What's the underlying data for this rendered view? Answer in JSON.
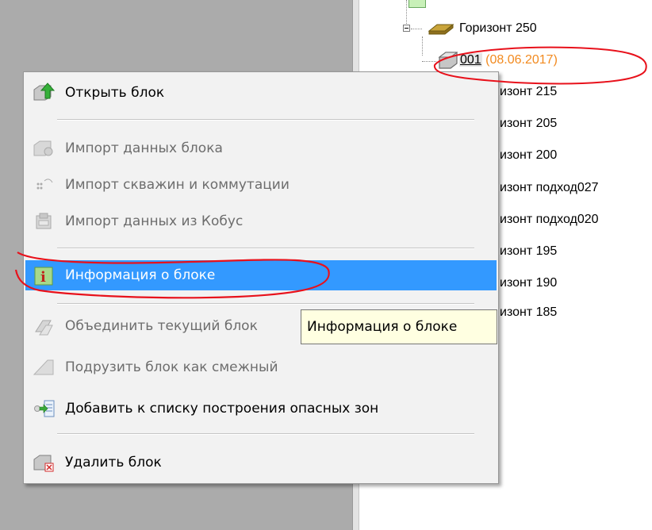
{
  "tree": {
    "items": [
      {
        "label": "Горизонт 250"
      },
      {
        "code": "001",
        "date": "(08.06.2017)"
      },
      {
        "label": "изонт 215"
      },
      {
        "label": "изонт 205"
      },
      {
        "label": "изонт 200"
      },
      {
        "label": "изонт подход027"
      },
      {
        "label": "изонт подход020"
      },
      {
        "label": "изонт 195"
      },
      {
        "label": "изонт 190"
      },
      {
        "label": "изонт 185"
      }
    ]
  },
  "menu": {
    "items": [
      {
        "label": "Открыть блок",
        "icon": "open-block-icon",
        "enabled": true
      },
      {
        "label": "Импорт данных блока",
        "icon": "import-block-icon",
        "enabled": false
      },
      {
        "label": "Импорт скважин и коммутации",
        "icon": "import-wells-icon",
        "enabled": false
      },
      {
        "label": "Импорт данных из Кобус",
        "icon": "import-kobus-icon",
        "enabled": false
      },
      {
        "label": "Информация о блоке",
        "icon": "info-icon",
        "enabled": true,
        "selected": true
      },
      {
        "label": "Объединить текущий блок",
        "icon": "merge-icon",
        "enabled": false
      },
      {
        "label": "Подрузить блок как смежный",
        "icon": "adjacent-block-icon",
        "enabled": false
      },
      {
        "label": "Добавить к списку построения опасных зон",
        "icon": "add-to-list-icon",
        "enabled": true
      },
      {
        "label": "Удалить блок",
        "icon": "delete-block-icon",
        "enabled": true
      }
    ]
  },
  "tooltip": {
    "text": "Информация о блоке"
  },
  "colors": {
    "highlight": "#3399ff",
    "date": "#f28a1f",
    "annotation": "#e8111b"
  }
}
